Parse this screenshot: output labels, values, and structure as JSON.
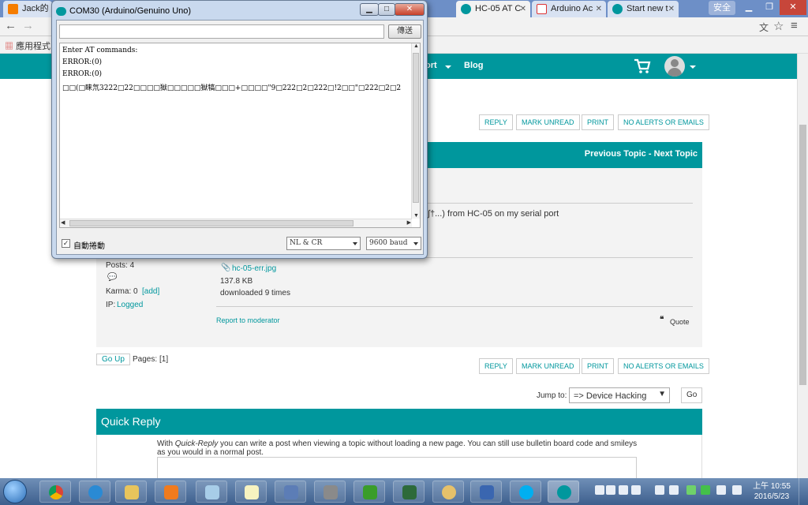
{
  "browser": {
    "tabs": [
      {
        "title": "Jack的",
        "active": false
      },
      {
        "title": "HC-05 AT C",
        "active": true
      },
      {
        "title": "Arduino Ac",
        "active": false
      },
      {
        "title": "Start new t",
        "active": false
      }
    ],
    "user_badge": "安全",
    "bookmarks_label": "應用程式"
  },
  "site": {
    "nav": {
      "support": "ort",
      "blog": "Blog"
    },
    "actions_top": [
      "REPLY",
      "MARK UNREAD",
      "PRINT",
      "NO ALERTS OR EMAILS"
    ],
    "actions_bottom": [
      "REPLY",
      "MARK UNREAD",
      "PRINT",
      "NO ALERTS OR EMAILS"
    ],
    "prev_next": "Previous Topic - Next Topic",
    "post": {
      "body_fragment": "∫†...) from HC-05 on my serial port",
      "posts": "Posts: 4",
      "karma_label": "Karma: 0",
      "karma_add": "[add]",
      "ip_label": "IP:",
      "ip_value": "Logged",
      "attachment": "hc-05-err.jpg",
      "size": "137.8 KB",
      "downloads": "downloaded 9 times",
      "report": "Report to moderator",
      "quote": "Quote"
    },
    "go_up": "Go Up",
    "pages_label": "Pages:",
    "pages_value": "[1]",
    "jump_label": "Jump to:",
    "jump_value": "=> Device Hacking",
    "go_label": "Go",
    "quick_reply": {
      "title": "Quick Reply",
      "desc_pre": "With ",
      "desc_em": "Quick-Reply",
      "desc_post": " you can write a post when viewing a topic without loading a new page. You can still use bulletin board code and smileys as you would in a normal post."
    }
  },
  "serial_monitor": {
    "title": "COM30 (Arduino/Genuino Uno)",
    "input_value": "",
    "send_label": "傳送",
    "lines": [
      "Enter AT commands:",
      " ERROR:(0)",
      "ERROR:(0)",
      " □□(□睐氘3222□22□□□□獄□□□□□獄犒□□□+□□□□\"9□222□2□222□!2□□\"□222□2□2"
    ],
    "autoscroll_label": "自動捲動",
    "autoscroll_checked": true,
    "line_ending": "NL & CR",
    "baud": "9600 baud"
  },
  "taskbar": {
    "clock_time": "上午 10:55",
    "clock_date": "2016/5/23"
  },
  "colors": {
    "arduino_teal": "#00979d",
    "chrome_frame": "#6d8fc7",
    "taskbar": "#3d5f8d"
  }
}
